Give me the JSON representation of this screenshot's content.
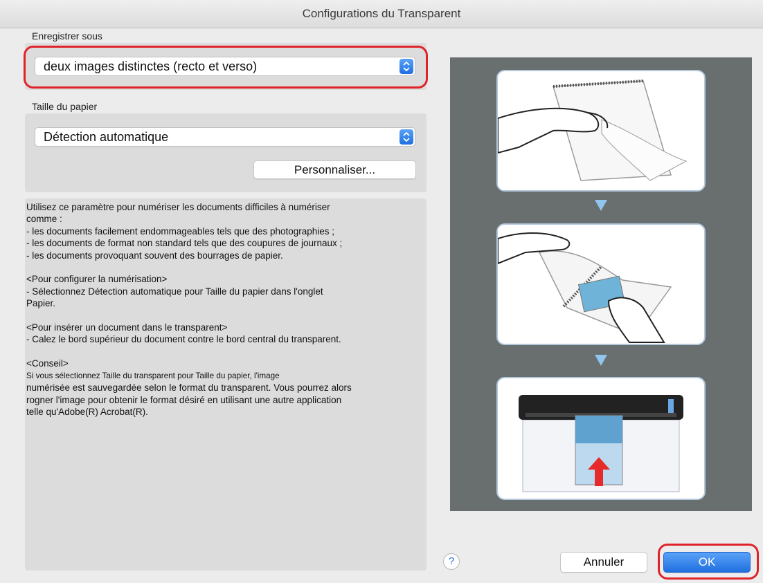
{
  "window": {
    "title": "Configurations du Transparent"
  },
  "save_as": {
    "label": "Enregistrer sous",
    "value": "deux images distinctes (recto et verso)"
  },
  "paper_size": {
    "label": "Taille du papier",
    "value": "Détection automatique",
    "customize_label": "Personnaliser..."
  },
  "description": {
    "lines": [
      "Utilisez ce paramètre pour numériser les documents difficiles à numériser",
      "comme :",
      "- les documents facilement endommageables tels que des photographies ;",
      "- les documents de format non standard tels que des coupures de journaux ;",
      "- les documents provoquant souvent des bourrages de papier.",
      "",
      "<Pour configurer la numérisation>",
      "- Sélectionnez Détection automatique pour Taille du papier dans l'onglet",
      "Papier.",
      "",
      "<Pour insérer un document dans le transparent>",
      "- Calez le bord supérieur du document contre le bord central du transparent.",
      "",
      "<Conseil>"
    ],
    "tip_small": "Si vous sélectionnez Taille du transparent pour Taille du papier, l'image",
    "tip_lines": [
      "numérisée est sauvegardée selon le format du transparent. Vous pourrez alors",
      "rogner l'image pour obtenir le format désiré en utilisant une autre application",
      "telle qu'Adobe(R) Acrobat(R)."
    ]
  },
  "footer": {
    "help_label": "?",
    "cancel_label": "Annuler",
    "ok_label": "OK"
  },
  "colors": {
    "accent": "#1f6fe0",
    "highlight_ring": "#e0232a",
    "illustration_bg": "#696e6e"
  }
}
